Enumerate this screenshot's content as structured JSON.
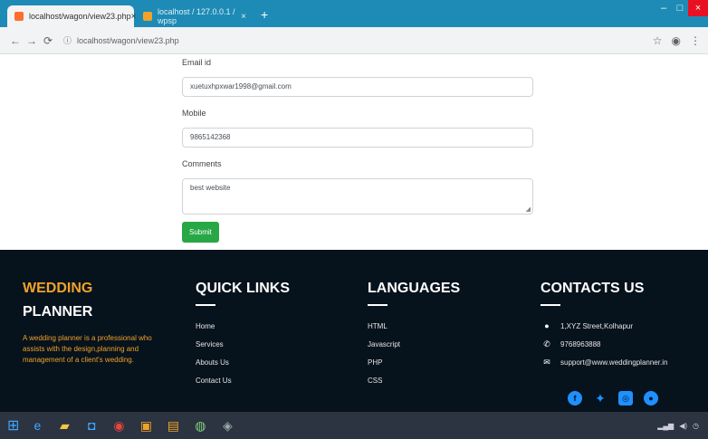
{
  "browser": {
    "tabs": [
      {
        "title": "localhost/wagon/view23.php",
        "active": true
      },
      {
        "title": "localhost / 127.0.0.1 / wpsp",
        "active": false
      }
    ],
    "url": "localhost/wagon/view23.php"
  },
  "form": {
    "email_label": "Email id",
    "email_value": "xuetuxhpxwar1998@gmail.com",
    "mobile_label": "Mobile",
    "mobile_value": "9865142368",
    "comments_label": "Comments",
    "comments_value": "best website",
    "submit_label": "Submit"
  },
  "footer": {
    "brand_title": "WEDDING",
    "brand_sub": "PLANNER",
    "brand_desc": "A wedding planner is a professional who assists with the design,planning and management of a client's wedding.",
    "quick_links": {
      "title": "QUICK LINKS",
      "items": [
        "Home",
        "Services",
        "Abouts Us",
        "Contact Us"
      ]
    },
    "languages": {
      "title": "LANGUAGES",
      "items": [
        "HTML",
        "Javascript",
        "PHP",
        "CSS"
      ]
    },
    "contacts": {
      "title": "CONTACTS US",
      "items": [
        {
          "icon": "map-marker-icon",
          "text": "1,XYZ Street,Kolhapur"
        },
        {
          "icon": "phone-icon",
          "text": "9768963888"
        },
        {
          "icon": "envelope-icon",
          "text": "support@www.weddingplanner.in"
        }
      ]
    }
  },
  "colors": {
    "footer_bg": "#06121c",
    "brand_accent": "#f0a229",
    "submit_green": "#28a745",
    "social_blue": "#1e90ff"
  }
}
